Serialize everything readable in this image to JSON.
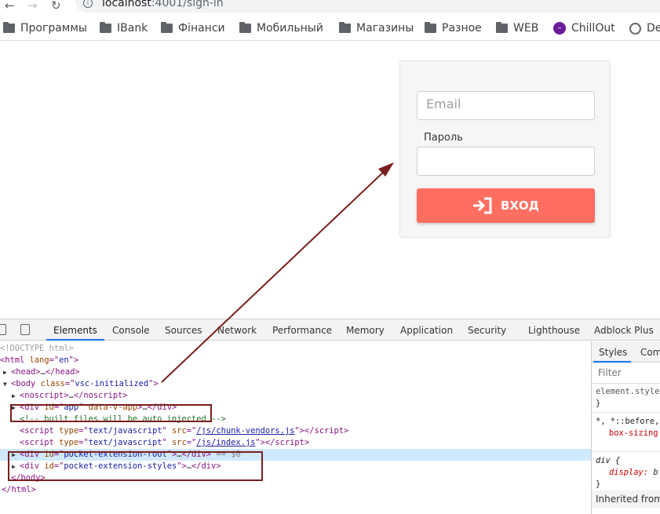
{
  "browser": {
    "url_host": "localhost",
    "url_path": ":4001/sign-in",
    "bookmarks": [
      {
        "label": "Программы",
        "icon": "folder-icon"
      },
      {
        "label": "IBank",
        "icon": "folder-icon"
      },
      {
        "label": "Фінанси",
        "icon": "folder-icon"
      },
      {
        "label": "Мобильный",
        "icon": "folder-icon"
      },
      {
        "label": "Магазины",
        "icon": "folder-icon"
      },
      {
        "label": "Разное",
        "icon": "folder-icon"
      },
      {
        "label": "WEB",
        "icon": "folder-icon"
      },
      {
        "label": "ChillOut",
        "icon": "chillout-icon"
      },
      {
        "label": "De",
        "icon": "globe-icon"
      }
    ]
  },
  "login": {
    "email_placeholder": "Email",
    "password_label": "Пароль",
    "password_placeholder": "",
    "submit_label": "ВХОД",
    "accent_color": "#ff6f61"
  },
  "devtools": {
    "tabs": [
      "Elements",
      "Console",
      "Sources",
      "Network",
      "Performance",
      "Memory",
      "Application",
      "Security",
      "Lighthouse",
      "Adblock Plus"
    ],
    "active_tab": "Elements",
    "dom": {
      "doctype": "<!DOCTYPE html>",
      "html_open_tag": "html",
      "html_attr": "lang",
      "html_val": "en",
      "head": "head",
      "body_tag": "body",
      "body_attr": "class",
      "body_val": "vsc-initialized",
      "noscript": "noscript",
      "div_tag": "div",
      "id_attr": "id",
      "app_id": "app",
      "app_extra_attr": "data-v-app",
      "comment": "<!-- built files will be auto injected -->",
      "script_tag": "script",
      "type_attr": "type",
      "type_val": "text/javascript",
      "src_attr": "src",
      "src1": "/js/chunk-vendors.js",
      "src2": "/js/index.js",
      "pocket_root": "pocket-extension-root",
      "pocket_styles": "pocket-extension-styles",
      "selected_marker": "== $0",
      "close_body": "</body>",
      "close_html": "</html>",
      "ellipsis": "…"
    },
    "styles_pane": {
      "tabs": [
        "Styles",
        "Computed"
      ],
      "filter_placeholder": "Filter",
      "element_style": "element.style {",
      "close_brace": "}",
      "universal_selector": "*, *::before,",
      "box_sizing_prop": "box-sizing:",
      "div_selector": "div {",
      "display_prop": "display:",
      "display_val": "b",
      "inherited_label": "Inherited from"
    }
  }
}
